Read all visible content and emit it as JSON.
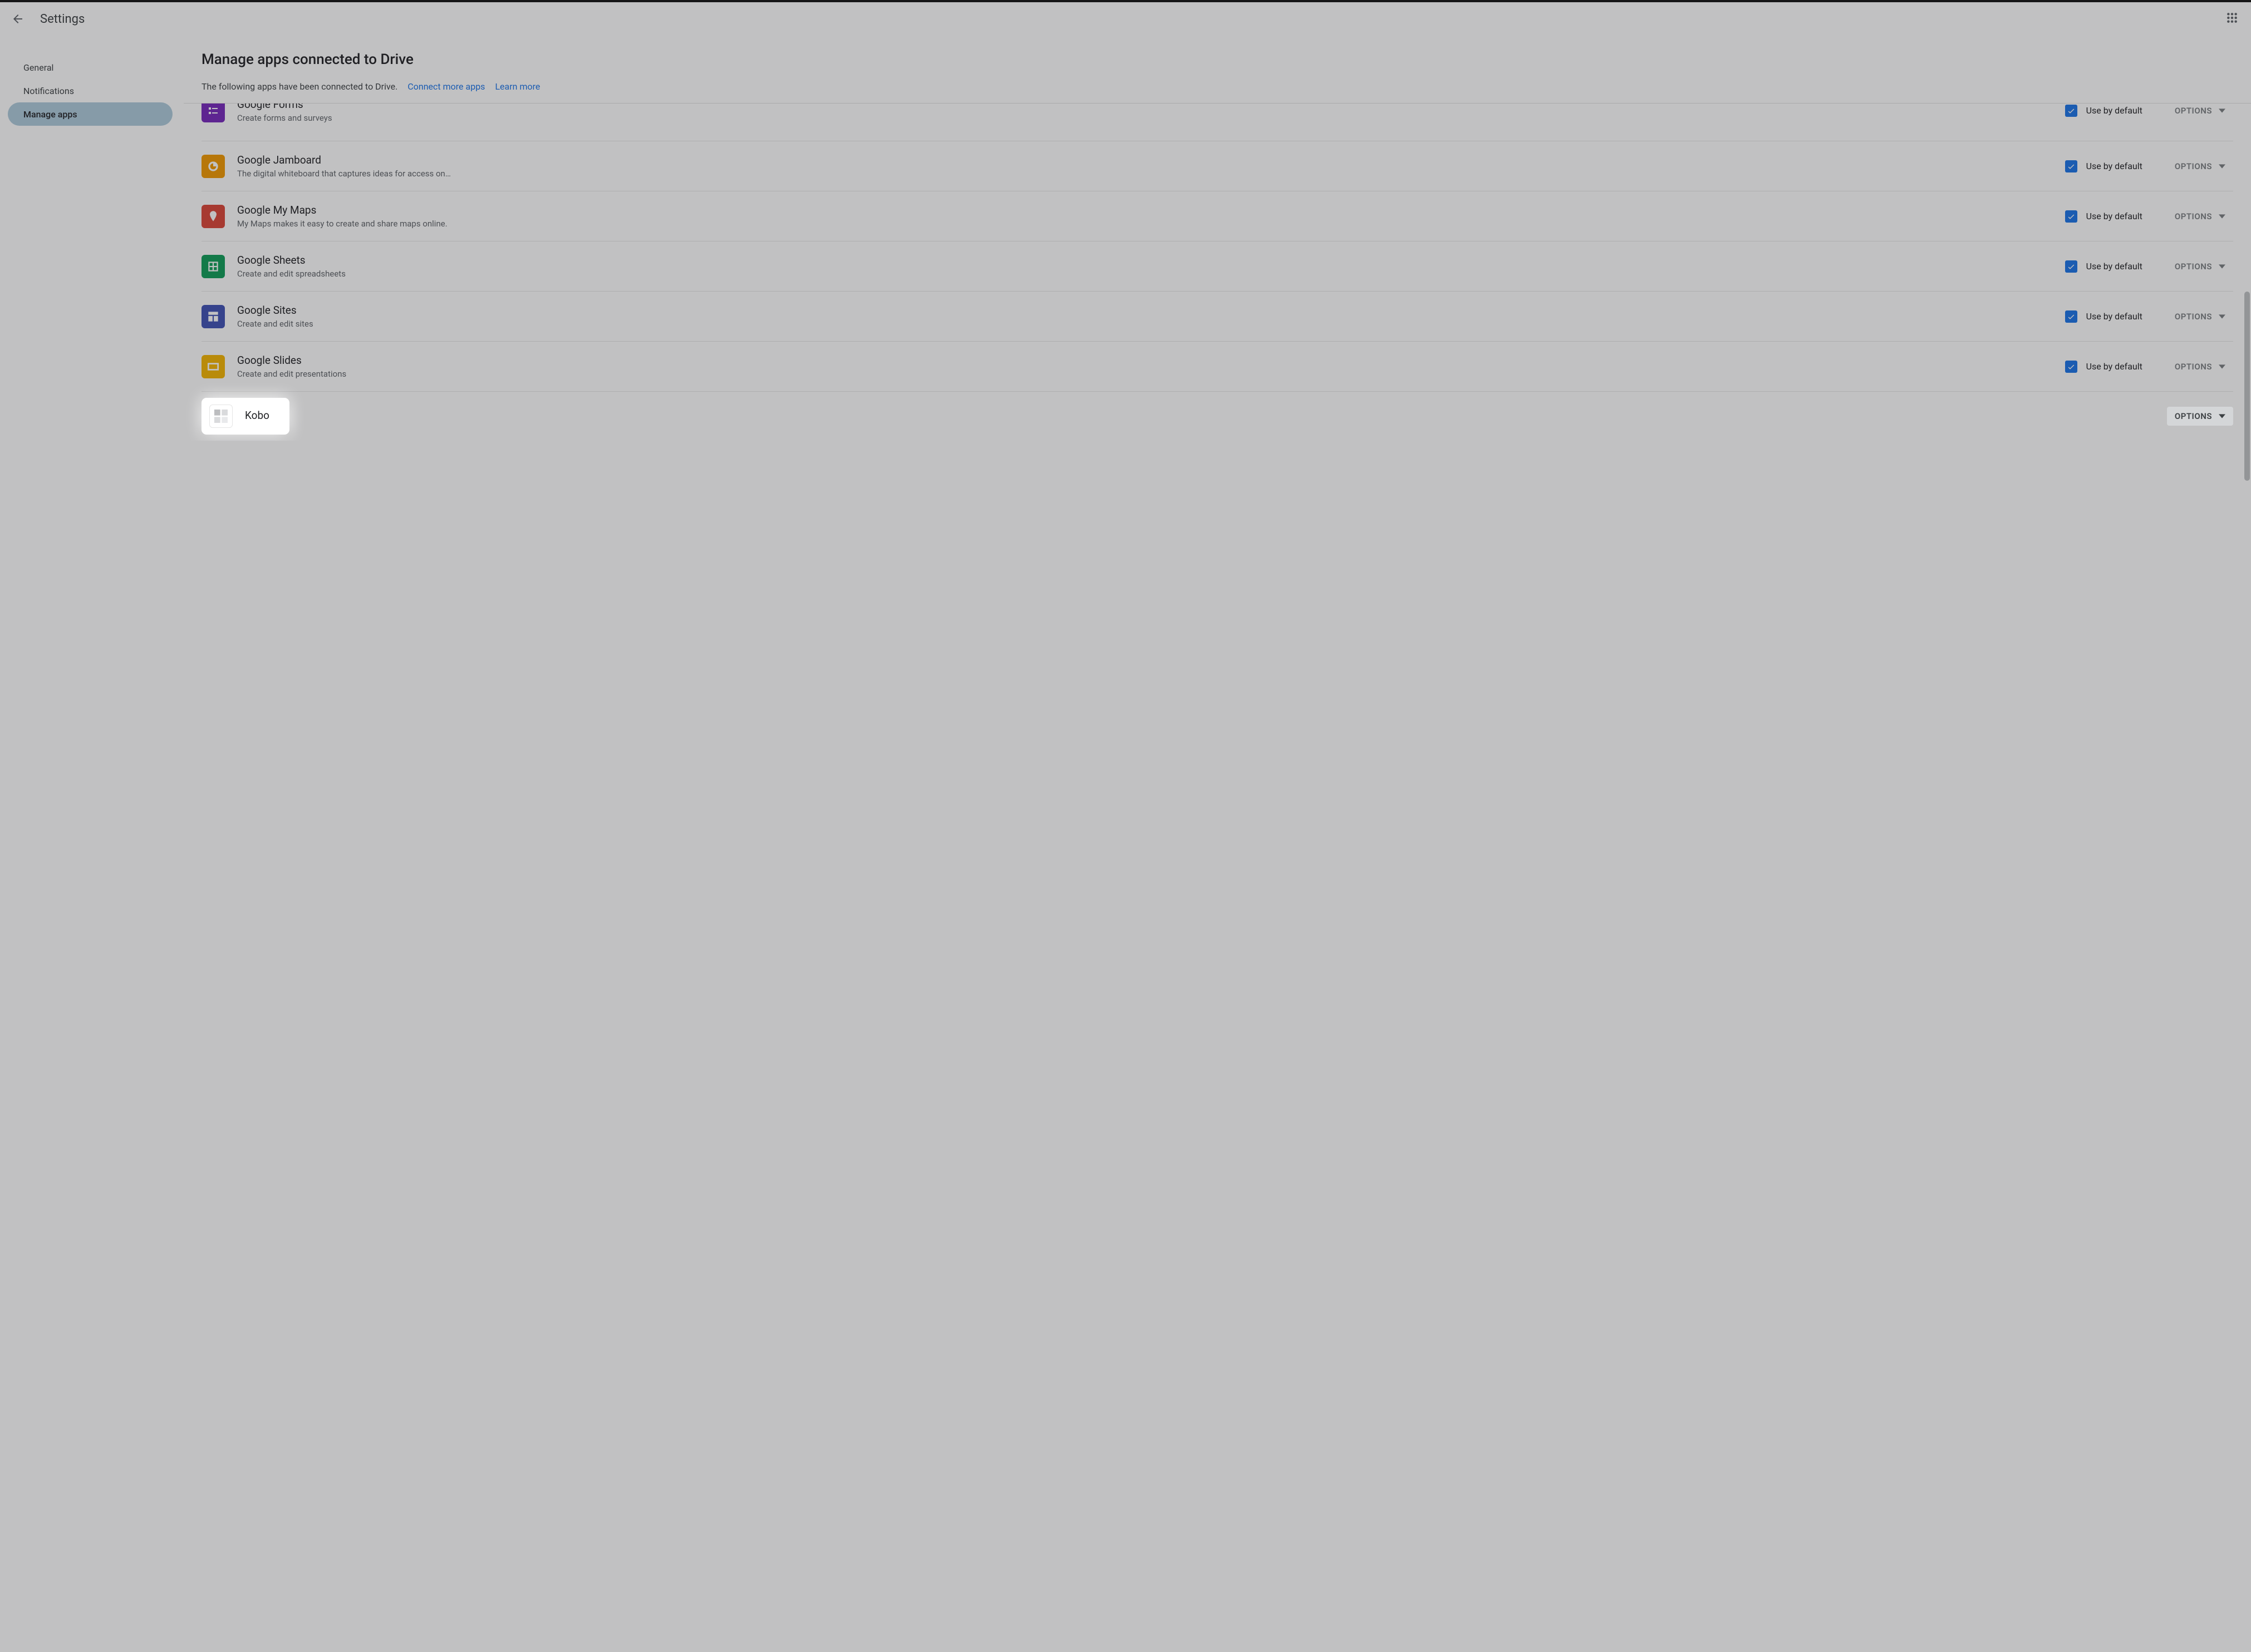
{
  "header": {
    "title": "Settings"
  },
  "sidebar": {
    "items": [
      {
        "label": "General",
        "selected": false
      },
      {
        "label": "Notifications",
        "selected": false
      },
      {
        "label": "Manage apps",
        "selected": true
      }
    ]
  },
  "main": {
    "title": "Manage apps connected to Drive",
    "subtitle": "The following apps have been connected to Drive.",
    "connect_link": "Connect more apps",
    "learn_link": "Learn more",
    "use_default_label": "Use by default",
    "options_label": "OPTIONS",
    "apps": [
      {
        "name": "Google Forms",
        "desc": "Create forms and surveys",
        "icon_bg": "#7627bb",
        "icon_type": "forms",
        "checked": true,
        "partial_top": true
      },
      {
        "name": "Google Jamboard",
        "desc": "The digital whiteboard that captures ideas for access on…",
        "icon_bg": "#f29900",
        "icon_type": "jamboard",
        "checked": true
      },
      {
        "name": "Google My Maps",
        "desc": "My Maps makes it easy to create and share maps online.",
        "icon_bg": "#db4437",
        "icon_type": "maps",
        "checked": true
      },
      {
        "name": "Google Sheets",
        "desc": "Create and edit spreadsheets",
        "icon_bg": "#0f9d58",
        "icon_type": "sheets",
        "checked": true
      },
      {
        "name": "Google Sites",
        "desc": "Create and edit sites",
        "icon_bg": "#3f51b5",
        "icon_type": "sites",
        "checked": true
      },
      {
        "name": "Google Slides",
        "desc": "Create and edit presentations",
        "icon_bg": "#f4b400",
        "icon_type": "slides",
        "checked": true
      },
      {
        "name": "Kobo",
        "desc": "",
        "icon_bg": "#ffffff",
        "icon_type": "kobo",
        "checked": false,
        "show_check": false,
        "boxed_options": true,
        "highlighted": true
      }
    ]
  }
}
